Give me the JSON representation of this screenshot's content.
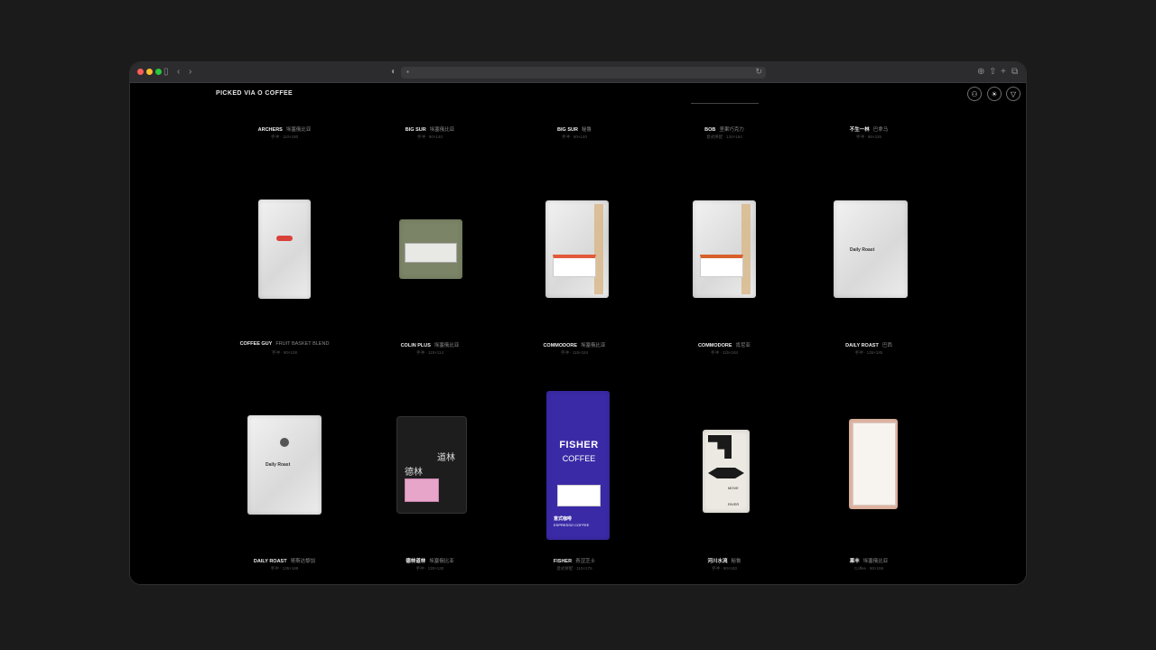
{
  "browser": {
    "back_icon": "chevron-left-icon",
    "forward_icon": "chevron-right-icon",
    "sidebar_icon": "sidebar-icon",
    "lock_icon": "lock-icon",
    "reload_icon": "reload-icon",
    "accent_traffic": [
      "#ff5f57",
      "#febc2e",
      "#28c840"
    ]
  },
  "header": {
    "title": "PICKED VIA O COFFEE",
    "buttons": [
      "user-icon",
      "sun-icon",
      "filter-icon"
    ]
  },
  "products": [
    {
      "brand": "ARCHERS",
      "name": "埃塞俄比亚",
      "meta": "手冲 · 110×180"
    },
    {
      "brand": "BIG SUR",
      "name": "埃塞俄比亚",
      "meta": "手冲 · 90×140"
    },
    {
      "brand": "BIG SUR",
      "name": "秘鲁",
      "meta": "手冲 · 90×140"
    },
    {
      "brand": "BOB",
      "name": "坚果巧克力",
      "meta": "意式拼配 · 134×164"
    },
    {
      "brand": "不生一林",
      "name": "巴拿马",
      "meta": "手冲 · 86×226"
    },
    {
      "brand": "COFFEE GUY",
      "name": "FRUIT BASKET BLEND",
      "meta": "手冲 · 90×108"
    },
    {
      "brand": "COLIN PLUS",
      "name": "埃塞俄比亚",
      "meta": "手冲 · 115×114"
    },
    {
      "brand": "COMMODORE",
      "name": "埃塞俄比亚",
      "meta": "手冲 · 115×184"
    },
    {
      "brand": "COMMODORE",
      "name": "肯尼亚",
      "meta": "手冲 · 115×184"
    },
    {
      "brand": "DAILY ROAST",
      "name": "巴西",
      "meta": "手冲 · 135×185"
    },
    {
      "brand": "DAILY ROAST",
      "name": "哥斯达黎加",
      "meta": "手冲 · 135×188"
    },
    {
      "brand": "德林道林",
      "name": "埃塞俄比亚",
      "meta": "手冲 · 130×130"
    },
    {
      "brand": "FISHER",
      "name": "青涩芝士",
      "meta": "意式拼配 · 110×176"
    },
    {
      "brand": "河川水流",
      "name": "秘鲁",
      "meta": "手冲 · 90×150"
    },
    {
      "brand": "果丰",
      "name": "埃塞俄比亚",
      "meta": "Coffee · 90×155"
    }
  ],
  "bag_text": {
    "daily_roast_1": "Daily Roast",
    "daily_roast_2": "Daily Roast",
    "delin_1": "德林",
    "delin_2": "道林",
    "fisher_1": "FISHER",
    "fisher_2": "COFFEE",
    "fisher_3": "意式咖啡",
    "fisher_4": "ESPRESSO COFFEE",
    "river_1": "MOVE",
    "river_2": "RIVER"
  }
}
